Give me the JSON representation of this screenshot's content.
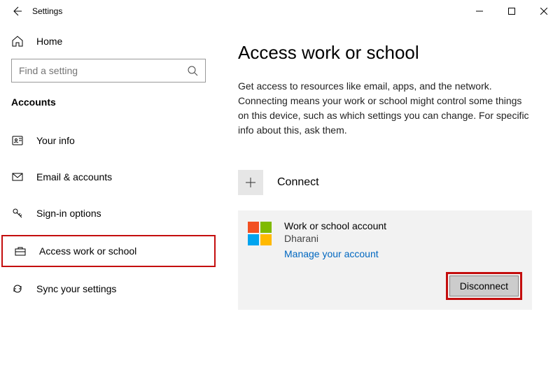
{
  "titlebar": {
    "title": "Settings"
  },
  "sidebar": {
    "home": "Home",
    "search_placeholder": "Find a setting",
    "section": "Accounts",
    "items": [
      {
        "label": "Your info"
      },
      {
        "label": "Email & accounts"
      },
      {
        "label": "Sign-in options"
      },
      {
        "label": "Access work or school"
      },
      {
        "label": "Sync your settings"
      }
    ]
  },
  "main": {
    "title": "Access work or school",
    "description": "Get access to resources like email, apps, and the network. Connecting means your work or school might control some things on this device, such as which settings you can change. For specific info about this, ask them.",
    "connect_label": "Connect",
    "account": {
      "title": "Work or school account",
      "subtitle": "Dharani",
      "manage_link": "Manage your account",
      "disconnect": "Disconnect"
    }
  }
}
